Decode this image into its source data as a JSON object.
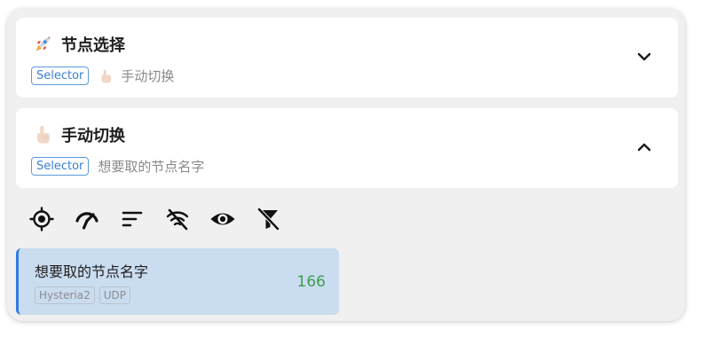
{
  "groups": [
    {
      "icon": "rocket-icon",
      "title": "节点选择",
      "type_badge": "Selector",
      "selected_icon": "pointing-hand-icon",
      "selected": "手动切换",
      "expanded": false
    },
    {
      "icon": "pointing-hand-icon",
      "title": "手动切换",
      "type_badge": "Selector",
      "selected": "想要取的节点名字",
      "expanded": true
    }
  ],
  "toolbar": {
    "icons": [
      "locate-icon",
      "delay-test-icon",
      "sort-icon",
      "filter-off-icon",
      "show-icon",
      "filter-clear-icon"
    ]
  },
  "proxy": {
    "name": "想要取的节点名字",
    "tags": [
      "Hysteria2",
      "UDP"
    ],
    "delay": "166"
  },
  "colors": {
    "accent": "#2f7be0",
    "badge_border": "#5b9be0",
    "selected_bg": "#cadcef",
    "delay_ok": "#3e9e4f"
  }
}
